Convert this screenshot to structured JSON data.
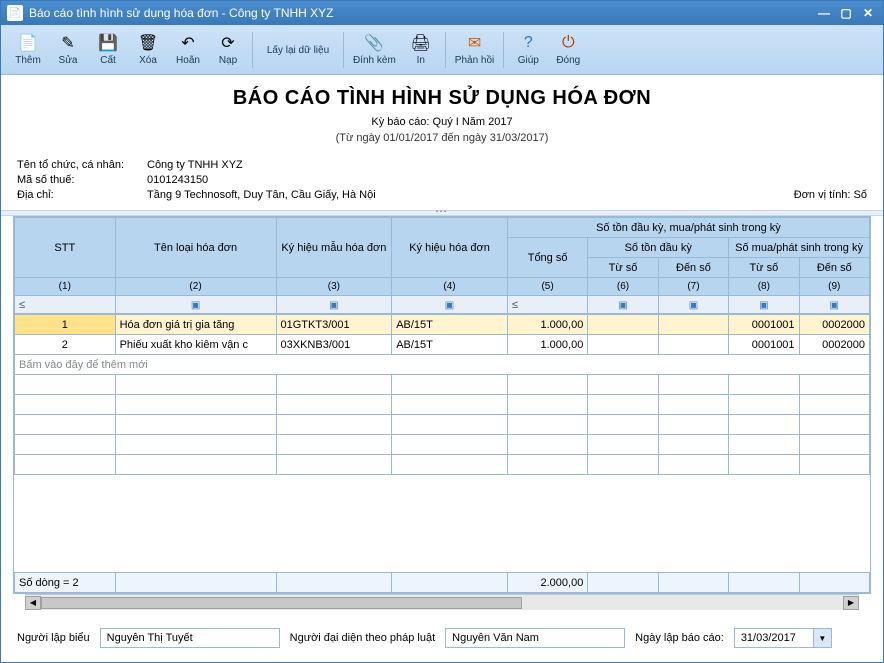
{
  "window": {
    "title": "Báo cáo tình hình sử dụng hóa đơn - Công ty TNHH XYZ"
  },
  "toolbar": {
    "add": "Thêm",
    "edit": "Sửa",
    "save": "Cất",
    "delete": "Xóa",
    "undo": "Hoãn",
    "load": "Nạp",
    "reload": "Lấy lại dữ liệu",
    "attach": "Đính kèm",
    "print": "In",
    "feedback": "Phản hồi",
    "help": "Giúp",
    "close": "Đóng"
  },
  "report": {
    "title": "BÁO CÁO TÌNH HÌNH SỬ DỤNG HÓA ĐƠN",
    "period": "Kỳ báo cáo: Quý I Năm 2017",
    "range": "(Từ ngày 01/01/2017 đến ngày 31/03/2017)"
  },
  "info": {
    "org_label": "Tên tổ chức, cá nhân:",
    "org_value": "Công ty TNHH XYZ",
    "tax_label": "Mã số thuế:",
    "tax_value": "0101243150",
    "addr_label": "Địa chỉ:",
    "addr_value": "Tầng 9 Technosoft, Duy Tân, Cầu Giấy, Hà Nội",
    "unit": "Đơn vị tính: Số"
  },
  "grid": {
    "headers": {
      "stt": "STT",
      "type": "Tên loại hóa đơn",
      "form": "Ký hiệu mẫu hóa đơn",
      "serial": "Ký hiệu hóa đơn",
      "group_top": "Số tồn đầu kỳ, mua/phát sinh trong kỳ",
      "total": "Tổng số",
      "opening": "Số tồn đầu kỳ",
      "purchase": "Số mua/phát sinh trong kỳ",
      "from": "Từ số",
      "to": "Đến số"
    },
    "nums": [
      "(1)",
      "(2)",
      "(3)",
      "(4)",
      "(5)",
      "(6)",
      "(7)",
      "(8)",
      "(9)"
    ],
    "filter_le": "≤",
    "rows": [
      {
        "stt": "1",
        "type": "Hóa đơn giá trị gia tăng",
        "form": "01GTKT3/001",
        "serial": "AB/15T",
        "total": "1.000,00",
        "ofrom": "",
        "oto": "",
        "pfrom": "0001001",
        "pto": "0002000"
      },
      {
        "stt": "2",
        "type": "Phiếu xuất kho kiêm vận c",
        "form": "03XKNB3/001",
        "serial": "AB/15T",
        "total": "1.000,00",
        "ofrom": "",
        "oto": "",
        "pfrom": "0001001",
        "pto": "0002000"
      }
    ],
    "add_hint": "Bấm vào đây để thêm mới",
    "footer": {
      "count": "Số dòng = 2",
      "total": "2.000,00"
    }
  },
  "form": {
    "preparer_label": "Người lập biểu",
    "preparer": "Nguyễn Thị Tuyết",
    "rep_label": "Người đại diện theo pháp luật",
    "rep": "Nguyễn Văn Nam",
    "date_label": "Ngày lập báo cáo:",
    "date": "31/03/2017"
  }
}
